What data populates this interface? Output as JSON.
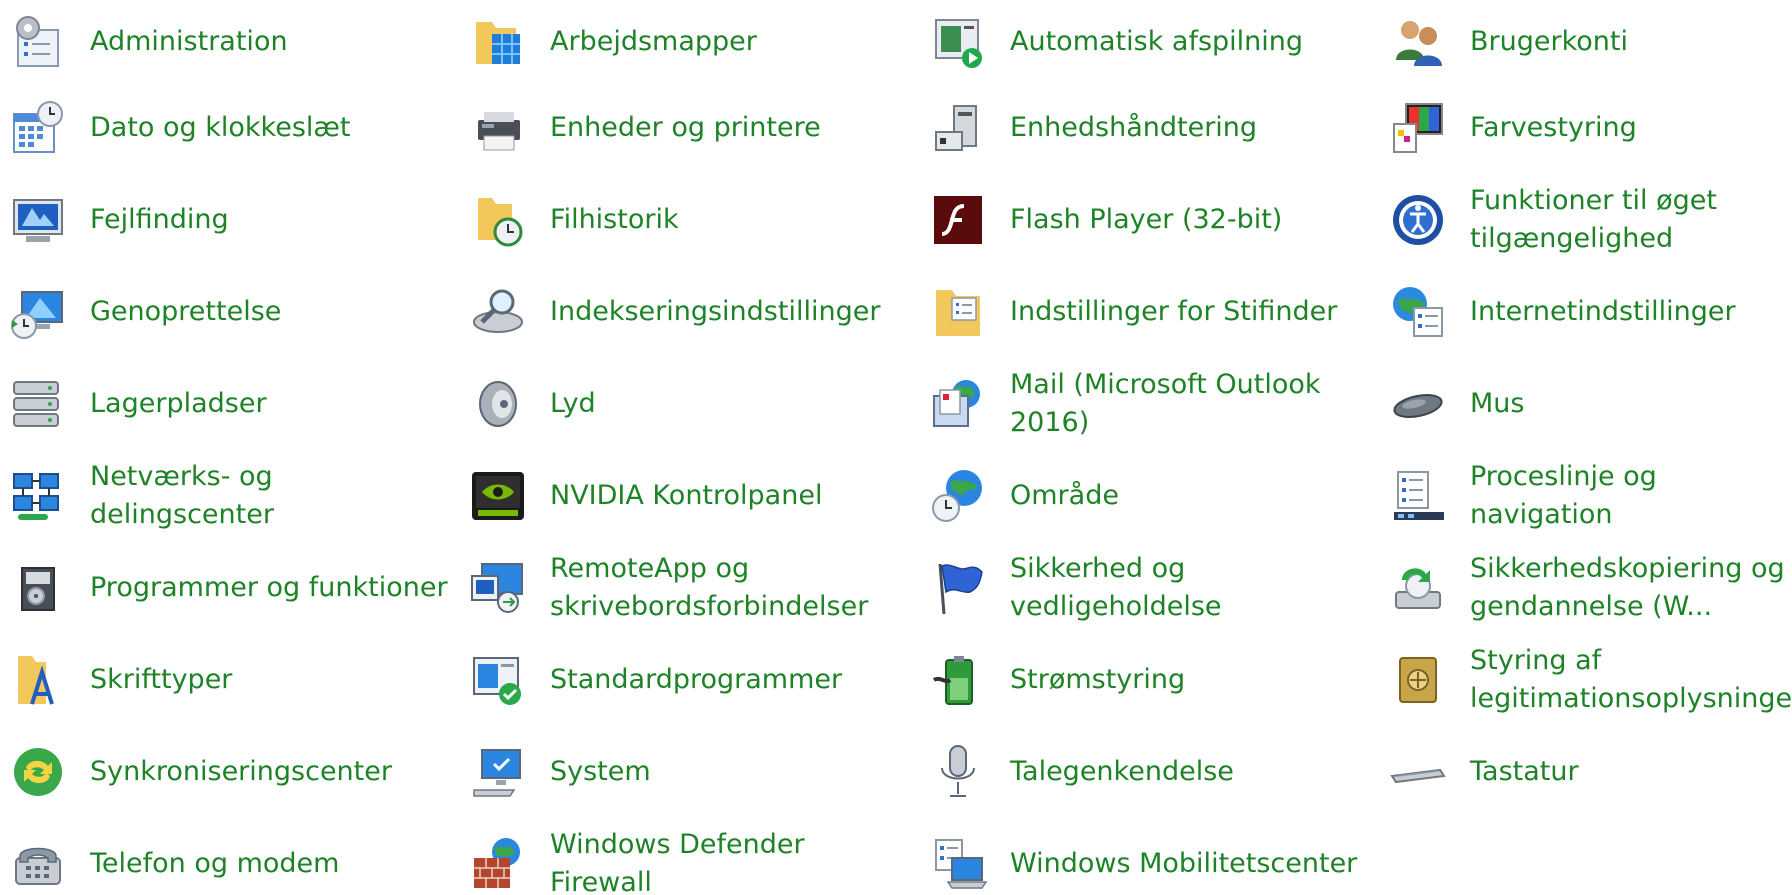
{
  "window": {
    "title": ""
  },
  "accent_color": "#1e8327",
  "items": [
    {
      "label": "Administration",
      "icon": "admin-tools-icon"
    },
    {
      "label": "Arbejdsmapper",
      "icon": "work-folders-icon"
    },
    {
      "label": "Automatisk afspilning",
      "icon": "autoplay-icon"
    },
    {
      "label": "Brugerkonti",
      "icon": "user-accounts-icon"
    },
    {
      "label": "Dato og klokkeslæt",
      "icon": "date-time-icon"
    },
    {
      "label": "Enheder og printere",
      "icon": "devices-printers-icon"
    },
    {
      "label": "Enhedshåndtering",
      "icon": "device-manager-icon"
    },
    {
      "label": "Farvestyring",
      "icon": "color-management-icon"
    },
    {
      "label": "Fejlfinding",
      "icon": "troubleshooting-icon"
    },
    {
      "label": "Filhistorik",
      "icon": "file-history-icon"
    },
    {
      "label": "Flash Player (32-bit)",
      "icon": "flash-player-icon"
    },
    {
      "label": "Funktioner til øget tilgængelighed",
      "icon": "ease-of-access-icon"
    },
    {
      "label": "Genoprettelse",
      "icon": "recovery-icon"
    },
    {
      "label": "Indekseringsindstillinger",
      "icon": "indexing-options-icon"
    },
    {
      "label": "Indstillinger for Stifinder",
      "icon": "explorer-options-icon"
    },
    {
      "label": "Internetindstillinger",
      "icon": "internet-options-icon"
    },
    {
      "label": "Lagerpladser",
      "icon": "storage-spaces-icon"
    },
    {
      "label": "Lyd",
      "icon": "sound-icon"
    },
    {
      "label": "Mail (Microsoft Outlook 2016)",
      "icon": "mail-icon"
    },
    {
      "label": "Mus",
      "icon": "mouse-icon"
    },
    {
      "label": "Netværks- og delingscenter",
      "icon": "network-sharing-icon"
    },
    {
      "label": "NVIDIA Kontrolpanel",
      "icon": "nvidia-icon"
    },
    {
      "label": "Område",
      "icon": "region-icon"
    },
    {
      "label": "Proceslinje og navigation",
      "icon": "taskbar-navigation-icon"
    },
    {
      "label": "Programmer og funktioner",
      "icon": "programs-features-icon"
    },
    {
      "label": "RemoteApp og skrivebordsforbindelser",
      "icon": "remoteapp-icon"
    },
    {
      "label": "Sikkerhed og vedligeholdelse",
      "icon": "security-maintenance-icon"
    },
    {
      "label": "Sikkerhedskopiering og gendannelse (W...",
      "icon": "backup-restore-icon"
    },
    {
      "label": "Skrifttyper",
      "icon": "fonts-icon"
    },
    {
      "label": "Standardprogrammer",
      "icon": "default-programs-icon"
    },
    {
      "label": "Strømstyring",
      "icon": "power-options-icon"
    },
    {
      "label": "Styring af legitimationsoplysninger",
      "icon": "credential-manager-icon"
    },
    {
      "label": "Synkroniseringscenter",
      "icon": "sync-center-icon"
    },
    {
      "label": "System",
      "icon": "system-icon"
    },
    {
      "label": "Talegenkendelse",
      "icon": "speech-recognition-icon"
    },
    {
      "label": "Tastatur",
      "icon": "keyboard-icon"
    },
    {
      "label": "Telefon og modem",
      "icon": "phone-modem-icon"
    },
    {
      "label": "Windows Defender Firewall",
      "icon": "firewall-icon"
    },
    {
      "label": "Windows Mobilitetscenter",
      "icon": "mobility-center-icon"
    }
  ]
}
